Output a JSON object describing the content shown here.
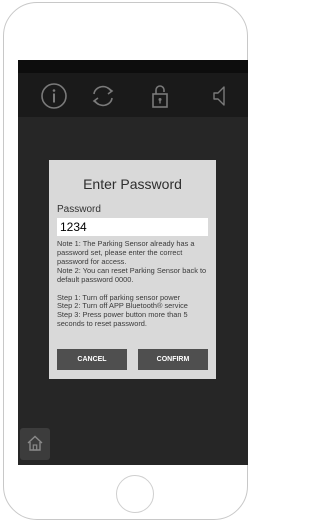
{
  "toolbar": {
    "icons": [
      "info-icon",
      "sync-icon",
      "lock-icon",
      "speaker-icon"
    ]
  },
  "dialog": {
    "title": "Enter Password",
    "field_label": "Password",
    "password_value": "1234",
    "note1": "Note 1: The Parking Sensor already has a password set, please enter the correct password for access.",
    "note2": "Note 2: You can reset Parking Sensor back to default password 0000.",
    "step1": "Step 1: Turn off parking sensor power",
    "step2": "Step 2: Turn off APP Bluetooth® service",
    "step3": "Step 3: Press power button more than 5 seconds to reset password.",
    "cancel_label": "CANCEL",
    "confirm_label": "CONFIRM"
  },
  "bottom": {
    "home_icon": "home-icon"
  },
  "colors": {
    "screen_bg": "#1a1a1a",
    "dialog_bg": "#d9d9d9",
    "button_bg": "#4f4f4f",
    "icon_color": "#7a7a7a"
  }
}
